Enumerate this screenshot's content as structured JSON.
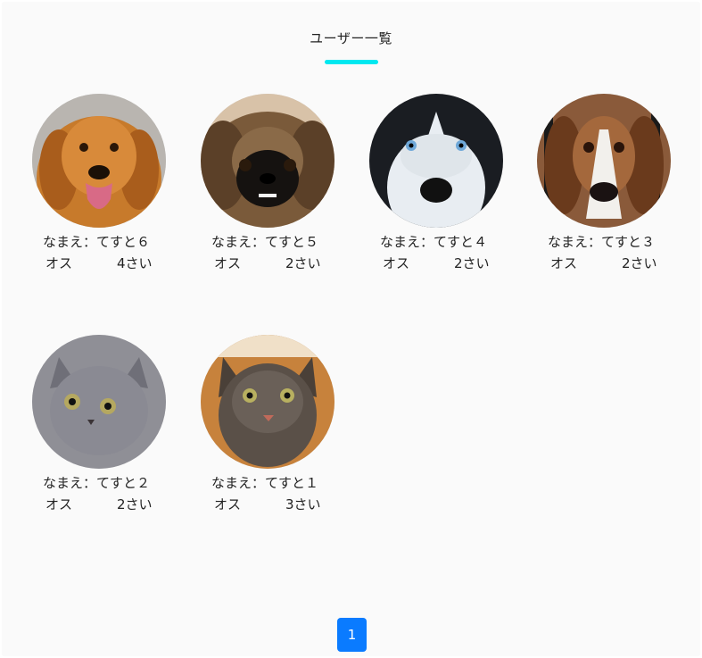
{
  "header": {
    "title": "ユーザー一覧"
  },
  "users": [
    {
      "name": "なまえ：てすと６",
      "sex": "オス",
      "age": "4さい",
      "photo": "golden-retriever-photo"
    },
    {
      "name": "なまえ：てすと５",
      "sex": "オス",
      "age": "2さい",
      "photo": "pekingese-photo"
    },
    {
      "name": "なまえ：てすと４",
      "sex": "オス",
      "age": "2さい",
      "photo": "husky-photo"
    },
    {
      "name": "なまえ：てすと３",
      "sex": "オス",
      "age": "2さい",
      "photo": "basset-hound-photo"
    },
    {
      "name": "なまえ：てすと２",
      "sex": "オス",
      "age": "2さい",
      "photo": "gray-kitten-photo"
    },
    {
      "name": "なまえ：てすと１",
      "sex": "オス",
      "age": "3さい",
      "photo": "tabby-cat-photo"
    }
  ],
  "pagination": {
    "current": "1"
  },
  "colors": {
    "accent": "#00e8f0",
    "page_button": "#0a7bff",
    "background": "#fafafa"
  }
}
